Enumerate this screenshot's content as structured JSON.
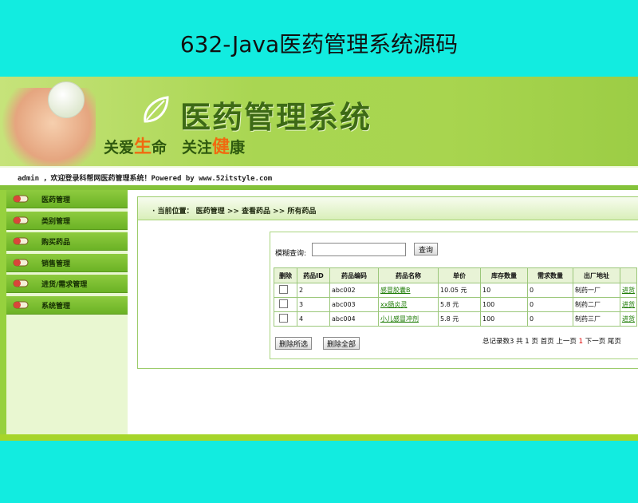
{
  "page_title": "632-Java医药管理系统源码",
  "banner": {
    "logo_text": "医药管理系统",
    "slogan_a": "关爱",
    "slogan_a_hl": "生",
    "slogan_b": "命　关注",
    "slogan_b_hl": "健",
    "slogan_c": "康"
  },
  "welcome": "admin ，欢迎登录科帮网医药管理系统！Powered by www.52itstyle.com",
  "sidebar": {
    "items": [
      {
        "label": "医药管理"
      },
      {
        "label": "类别管理"
      },
      {
        "label": "购买药品"
      },
      {
        "label": "销售管理"
      },
      {
        "label": "进货/需求管理"
      },
      {
        "label": "系统管理"
      }
    ]
  },
  "breadcrumb": "· 当前位置： 医药管理 >> 查看药品 >> 所有药品",
  "search": {
    "label": "模糊查询:",
    "value": "",
    "button": "查询"
  },
  "table": {
    "headers": [
      "删除",
      "药品ID",
      "药品编码",
      "药品名称",
      "单价",
      "库存数量",
      "需求数量",
      "出厂地址",
      ""
    ],
    "rows": [
      {
        "id": "2",
        "code": "abc002",
        "name": "感冒胶囊B",
        "price": "10.05 元",
        "stock": "10",
        "need": "0",
        "addr": "制药一厂",
        "op": "进货"
      },
      {
        "id": "3",
        "code": "abc003",
        "name": "xx肠炎灵",
        "price": "5.8 元",
        "stock": "100",
        "need": "0",
        "addr": "制药二厂",
        "op": "进货"
      },
      {
        "id": "4",
        "code": "abc004",
        "name": "小儿感冒冲剂",
        "price": "5.8 元",
        "stock": "100",
        "need": "0",
        "addr": "制药三厂",
        "op": "进货"
      }
    ]
  },
  "actions": {
    "delete_selected": "删除所选",
    "delete_all": "删除全部"
  },
  "pager": {
    "total_prefix": "总记录数3 共 1 页",
    "first": "首页",
    "prev": "上一页",
    "current": "1",
    "next": "下一页",
    "last": "尾页"
  },
  "colors": {
    "background": "#12ece0",
    "banner_green": "#a9d652",
    "sidebar_item": "#6bb225",
    "accent_orange": "#f06a10",
    "link_green": "#1a7a00"
  }
}
